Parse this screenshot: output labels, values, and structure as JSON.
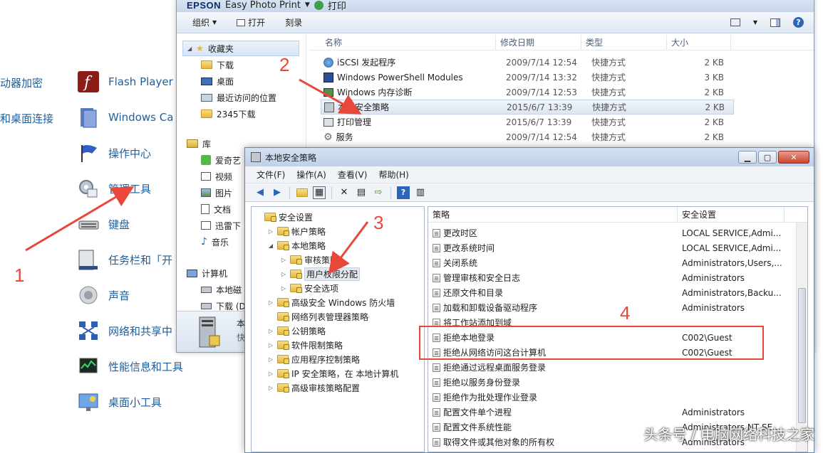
{
  "control_panel": {
    "left_partial": [
      "动器加密",
      "和桌面连接"
    ],
    "items": [
      {
        "label": "Flash Player",
        "icon": "flash-icon"
      },
      {
        "label": "Windows Ca",
        "icon": "cardspace-icon"
      },
      {
        "label": "操作中心",
        "icon": "flag-icon"
      },
      {
        "label": "管理工具",
        "icon": "admin-tools-icon"
      },
      {
        "label": "键盘",
        "icon": "keyboard-icon"
      },
      {
        "label": "任务栏和「开",
        "icon": "taskbar-icon"
      },
      {
        "label": "声音",
        "icon": "speaker-icon"
      },
      {
        "label": "网络和共享中",
        "icon": "network-icon"
      },
      {
        "label": "性能信息和工具",
        "icon": "performance-icon"
      },
      {
        "label": "桌面小工具",
        "icon": "gadgets-icon"
      }
    ]
  },
  "explorer": {
    "title_brand": "EPSON",
    "title_app": "Easy Photo Print",
    "title_print": "打印",
    "toolbar": {
      "organize": "组织",
      "open": "打开",
      "burn": "刻录"
    },
    "nav": {
      "favorites": "收藏夹",
      "fav_items": [
        "下载",
        "桌面",
        "最近访问的位置",
        "2345下载"
      ],
      "library": "库",
      "lib_items": [
        "爱奇艺",
        "视频",
        "图片",
        "文档",
        "迅雷下",
        "音乐"
      ],
      "computer": "计算机",
      "comp_items": [
        "本地磁",
        "下载 (D"
      ]
    },
    "status_partial": [
      "本",
      "快"
    ],
    "columns": [
      "名称",
      "修改日期",
      "类型",
      "大小"
    ],
    "rows": [
      {
        "name": "iSCSI 发起程序",
        "date": "2009/7/14 12:54",
        "type": "快捷方式",
        "size": "2 KB"
      },
      {
        "name": "Windows PowerShell Modules",
        "date": "2009/7/14 13:32",
        "type": "快捷方式",
        "size": "3 KB"
      },
      {
        "name": "Windows 内存诊断",
        "date": "2009/7/14 12:53",
        "type": "快捷方式",
        "size": "2 KB"
      },
      {
        "name": "本地安全策略",
        "date": "2015/6/7 13:39",
        "type": "快捷方式",
        "size": "2 KB"
      },
      {
        "name": "打印管理",
        "date": "2015/6/7 13:39",
        "type": "快捷方式",
        "size": "2 KB"
      },
      {
        "name": "服务",
        "date": "2009/7/14 12:54",
        "type": "快捷方式",
        "size": "2 KB"
      }
    ]
  },
  "lsp": {
    "title": "本地安全策略",
    "menu": [
      "文件(F)",
      "操作(A)",
      "查看(V)",
      "帮助(H)"
    ],
    "tree": [
      {
        "label": "安全设置",
        "level": 0,
        "expander": ""
      },
      {
        "label": "帐户策略",
        "level": 1,
        "expander": "▷"
      },
      {
        "label": "本地策略",
        "level": 1,
        "expander": "◢"
      },
      {
        "label": "审核策略",
        "level": 2,
        "expander": "▷"
      },
      {
        "label": "用户权限分配",
        "level": 2,
        "expander": "▷",
        "selected": true
      },
      {
        "label": "安全选项",
        "level": 2,
        "expander": "▷"
      },
      {
        "label": "高级安全 Windows 防火墙",
        "level": 1,
        "expander": "▷"
      },
      {
        "label": "网络列表管理器策略",
        "level": 1,
        "expander": ""
      },
      {
        "label": "公钥策略",
        "level": 1,
        "expander": "▷"
      },
      {
        "label": "软件限制策略",
        "level": 1,
        "expander": "▷"
      },
      {
        "label": "应用程序控制策略",
        "level": 1,
        "expander": "▷"
      },
      {
        "label": "IP 安全策略，在 本地计算机",
        "level": 1,
        "expander": "▷"
      },
      {
        "label": "高级审核策略配置",
        "level": 1,
        "expander": "▷"
      }
    ],
    "columns": [
      "策略",
      "安全设置"
    ],
    "rows": [
      {
        "policy": "更改时区",
        "setting": "LOCAL SERVICE,Admi..."
      },
      {
        "policy": "更改系统时间",
        "setting": "LOCAL SERVICE,Admi..."
      },
      {
        "policy": "关闭系统",
        "setting": "Administrators,Users,..."
      },
      {
        "policy": "管理审核和安全日志",
        "setting": "Administrators"
      },
      {
        "policy": "还原文件和目录",
        "setting": "Administrators,Backu..."
      },
      {
        "policy": "加载和卸载设备驱动程序",
        "setting": "Administrators"
      },
      {
        "policy": "将工作站添加到域",
        "setting": ""
      },
      {
        "policy": "拒绝本地登录",
        "setting": "C002\\Guest"
      },
      {
        "policy": "拒绝从网络访问这台计算机",
        "setting": "C002\\Guest"
      },
      {
        "policy": "拒绝通过远程桌面服务登录",
        "setting": ""
      },
      {
        "policy": "拒绝以服务身份登录",
        "setting": ""
      },
      {
        "policy": "拒绝作为批处理作业登录",
        "setting": ""
      },
      {
        "policy": "配置文件单个进程",
        "setting": "Administrators"
      },
      {
        "policy": "配置文件系统性能",
        "setting": "Administrators,NT SE..."
      },
      {
        "policy": "取得文件或其他对象的所有权",
        "setting": "Administrators"
      }
    ]
  },
  "annotations": {
    "n1": "1",
    "n2": "2",
    "n3": "3",
    "n4": "4",
    "color": "#e8473a"
  },
  "watermark": "头条号 / 电脑网络科技之家"
}
